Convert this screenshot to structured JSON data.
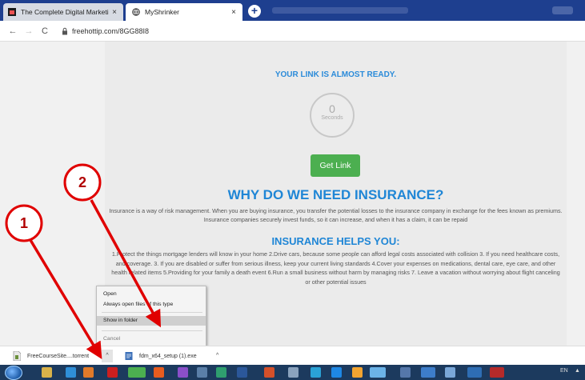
{
  "browser": {
    "tabs": [
      {
        "title": "The Complete Digital Marketing",
        "close": "×"
      },
      {
        "title": "MyShrinker",
        "close": "×"
      }
    ],
    "new_tab": "+",
    "nav": {
      "back": "←",
      "forward": "→",
      "reload": "C"
    },
    "url": "freehottip.com/8GG88I8"
  },
  "page": {
    "ready_text": "YOUR LINK IS ALMOST READY.",
    "countdown": {
      "value": "0",
      "unit": "Seconds"
    },
    "get_link_label": "Get Link",
    "heading_why": "WHY DO WE NEED INSURANCE?",
    "para_why": "Insurance is a way of risk management. When you are buying insurance, you transfer the potential losses to the insurance company in exchange for the fees known as premiums. Insurance companies securely invest funds, so it can increase, and when it has a claim, it can be repaid",
    "heading_helps": "INSURANCE HELPS YOU:",
    "para_helps": "1.Protect the things mortgage lenders will know in your home 2.Drive cars, because some people can afford legal costs associated with collision 3. If you need healthcare costs, and coverage. 3. If you are disabled or suffer from serious illness, keep your current living standards 4.Cover your expenses on medications, dental care, eye care, and other health related items 5.Providing for your family a death event 6.Run a small business without harm by managing risks 7. Leave a vacation without worrying about flight canceling or other potential issues"
  },
  "context_menu": {
    "items": [
      "Open",
      "Always open files of this type",
      "Show in folder",
      "Cancel"
    ],
    "highlighted": "Show in folder"
  },
  "download_bar": {
    "items": [
      {
        "name": "FreeCourseSite....torrent",
        "chevron": "^"
      },
      {
        "name": "fdm_x64_setup (1).exe",
        "chevron": "^"
      }
    ]
  },
  "taskbar": {
    "language": "EN",
    "tray_arrow": "▲"
  },
  "annotations": {
    "labels": [
      "1",
      "2"
    ],
    "color": "#e00000"
  },
  "colors": {
    "tab_strip": "#1e3f8f",
    "accent_blue": "#1f86d6",
    "get_link_green": "#4caf50",
    "taskbar": "#1c3a5e"
  }
}
